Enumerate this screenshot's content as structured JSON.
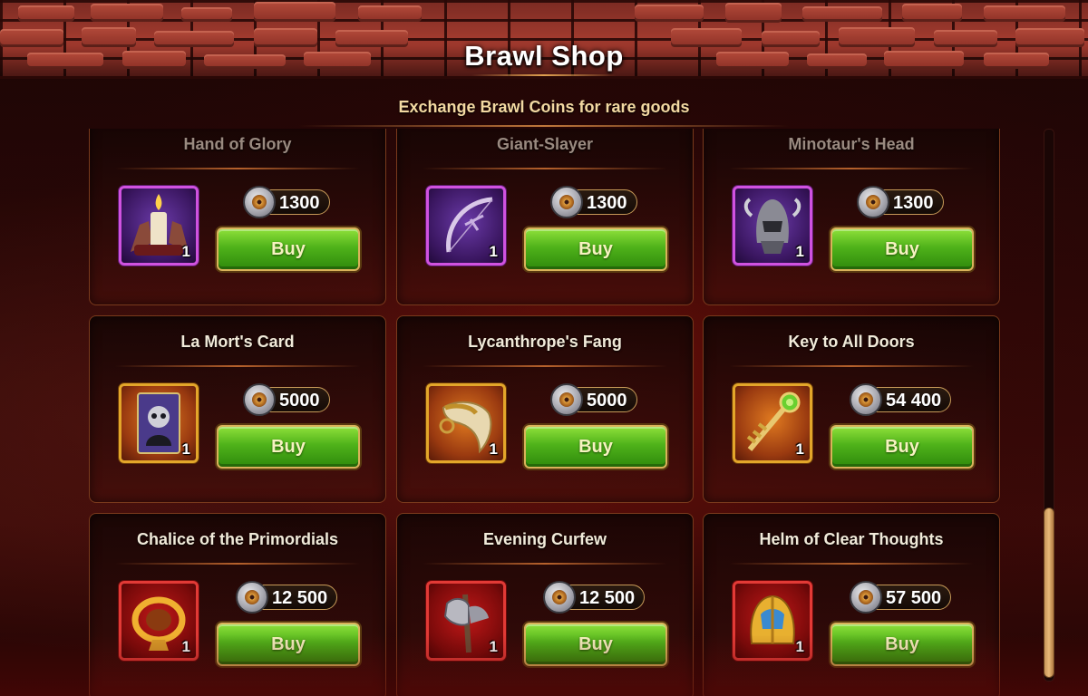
{
  "header": {
    "title": "Brawl Shop",
    "subtitle": "Exchange Brawl Coins for rare goods"
  },
  "buy_label": "Buy",
  "items": [
    {
      "name": "Hand of Glory",
      "price": "1300",
      "qty": "1",
      "rarity": "purple",
      "icon": "candle-hand-icon"
    },
    {
      "name": "Giant-Slayer",
      "price": "1300",
      "qty": "1",
      "rarity": "purple",
      "icon": "bow-icon"
    },
    {
      "name": "Minotaur's Head",
      "price": "1300",
      "qty": "1",
      "rarity": "purple",
      "icon": "helmet-icon"
    },
    {
      "name": "La Mort's Card",
      "price": "5000",
      "qty": "1",
      "rarity": "gold",
      "icon": "card-icon"
    },
    {
      "name": "Lycanthrope's Fang",
      "price": "5000",
      "qty": "1",
      "rarity": "gold",
      "icon": "fang-icon"
    },
    {
      "name": "Key to All Doors",
      "price": "54 400",
      "qty": "1",
      "rarity": "gold",
      "icon": "key-icon"
    },
    {
      "name": "Chalice of the Primordials",
      "price": "12 500",
      "qty": "1",
      "rarity": "red",
      "icon": "chalice-icon"
    },
    {
      "name": "Evening Curfew",
      "price": "12 500",
      "qty": "1",
      "rarity": "red",
      "icon": "axe-icon"
    },
    {
      "name": "Helm of Clear Thoughts",
      "price": "57 500",
      "qty": "1",
      "rarity": "red",
      "icon": "helm-icon"
    }
  ],
  "colors": {
    "purple_frame": "#d052e0",
    "gold_frame": "#e3a62a",
    "red_frame": "#e23a36",
    "buy_green": "#4fb21a"
  },
  "scroll_position": 0.85
}
